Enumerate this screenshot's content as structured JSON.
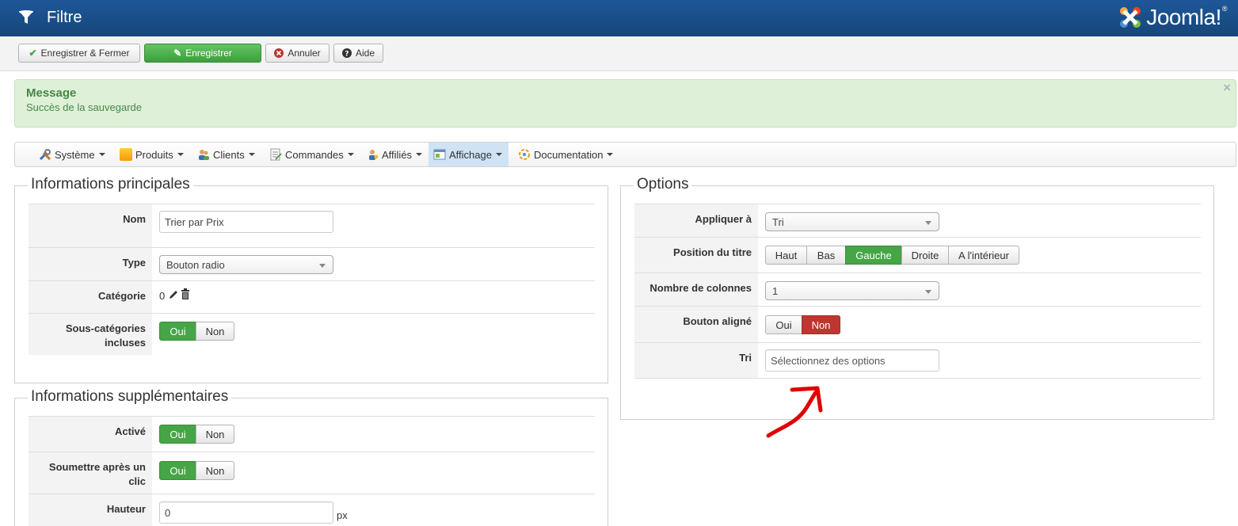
{
  "header": {
    "title": "Filtre",
    "logo_text": "Joomla!",
    "logo_reg": "®"
  },
  "toolbar": {
    "save_close": "Enregistrer & Fermer",
    "save": "Enregistrer",
    "cancel": "Annuler",
    "help": "Aide"
  },
  "message": {
    "heading": "Message",
    "text": "Succès de la sauvegarde",
    "close": "×"
  },
  "menu": {
    "items": [
      "Système",
      "Produits",
      "Clients",
      "Commandes",
      "Affiliés",
      "Affichage",
      "Documentation"
    ],
    "active": "Affichage"
  },
  "main_info": {
    "legend": "Informations principales",
    "name_label": "Nom",
    "name_value": "Trier par Prix",
    "type_label": "Type",
    "type_value": "Bouton radio",
    "category_label": "Catégorie",
    "category_value": "0",
    "subcat_label": "Sous-catégories incluses",
    "yes": "Oui",
    "no": "Non",
    "subcat_selected": "Oui"
  },
  "extra_info": {
    "legend": "Informations supplémentaires",
    "active_label": "Activé",
    "active_selected": "Oui",
    "submit_label": "Soumettre après un clic",
    "submit_selected": "Oui",
    "height_label": "Hauteur",
    "height_value": "0",
    "height_unit": "px",
    "yes": "Oui",
    "no": "Non"
  },
  "options": {
    "legend": "Options",
    "apply_label": "Appliquer à",
    "apply_value": "Tri",
    "title_pos_label": "Position du titre",
    "title_pos_options": [
      "Haut",
      "Bas",
      "Gauche",
      "Droite",
      "A l'intérieur"
    ],
    "title_pos_selected": "Gauche",
    "columns_label": "Nombre de colonnes",
    "columns_value": "1",
    "aligned_label": "Bouton aligné",
    "aligned_yes": "Oui",
    "aligned_no": "Non",
    "aligned_selected": "Non",
    "sort_label": "Tri",
    "sort_placeholder": "Sélectionnez des options"
  },
  "colors": {
    "header": "#1e5799",
    "success": "#46a546",
    "danger": "#bd362f",
    "annotation": "#e00000"
  }
}
